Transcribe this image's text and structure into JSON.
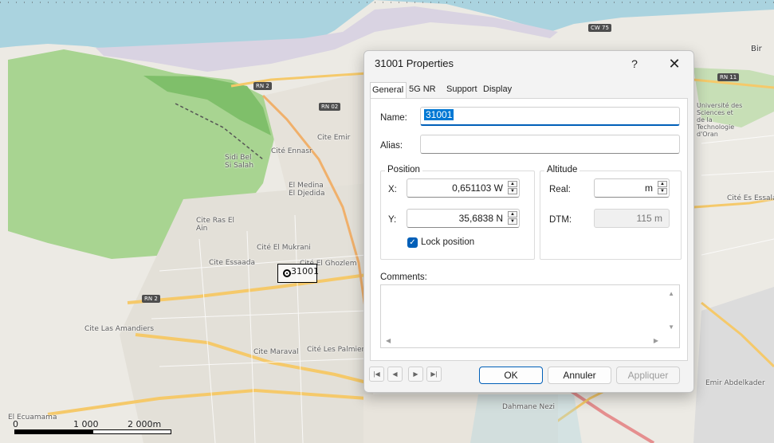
{
  "map": {
    "labels": [
      "Cite Emir",
      "Cité Ennasr",
      "Cite Ras El Ain",
      "Cité El Mukrani",
      "Cite Essaada",
      "Cité El Ghozlem",
      "Cite Las Amandiers",
      "Cite Maraval",
      "Cité Les Palmiers",
      "El Medina El Djedida",
      "Sidi Bel Si Salah",
      "Cité Es Essalam",
      "Emir Abdelkader",
      "Dahmane Nezi",
      "Bir",
      "Université des Sciences et de la Technologie d'Oran"
    ],
    "road_shields": [
      "RN 2",
      "RN 02",
      "RN 2",
      "CW 75",
      "RN 11"
    ],
    "site_marker_label": "31001",
    "scalebar": {
      "ticks": [
        "0",
        "1 000",
        "2 000m"
      ]
    },
    "bottom_left_label": "El Ecuamama"
  },
  "dialog": {
    "title": "31001 Properties",
    "help_label": "?",
    "close_label": "✕",
    "tabs": [
      "General",
      "5G NR",
      "Support",
      "Display"
    ],
    "active_tab": "General",
    "name_label": "Name:",
    "name_value": "31001",
    "alias_label": "Alias:",
    "alias_value": "",
    "position": {
      "title": "Position",
      "x_label": "X:",
      "x_value": "0,651103 W",
      "y_label": "Y:",
      "y_value": "35,6838 N",
      "lock_label": "Lock position",
      "lock_checked": true
    },
    "altitude": {
      "title": "Altitude",
      "real_label": "Real:",
      "real_value": "m",
      "dtm_label": "DTM:",
      "dtm_value": "115 m"
    },
    "comments_label": "Comments:",
    "comments_value": "",
    "buttons": {
      "ok": "OK",
      "cancel": "Annuler",
      "apply": "Appliquer"
    },
    "nav_icons": [
      "first-record-icon",
      "previous-record-icon",
      "next-record-icon",
      "last-record-icon"
    ]
  },
  "colors": {
    "accent": "#005fb8",
    "sea": "#aad3df",
    "park": "#8fc97b",
    "road_major": "#f5c96a"
  }
}
